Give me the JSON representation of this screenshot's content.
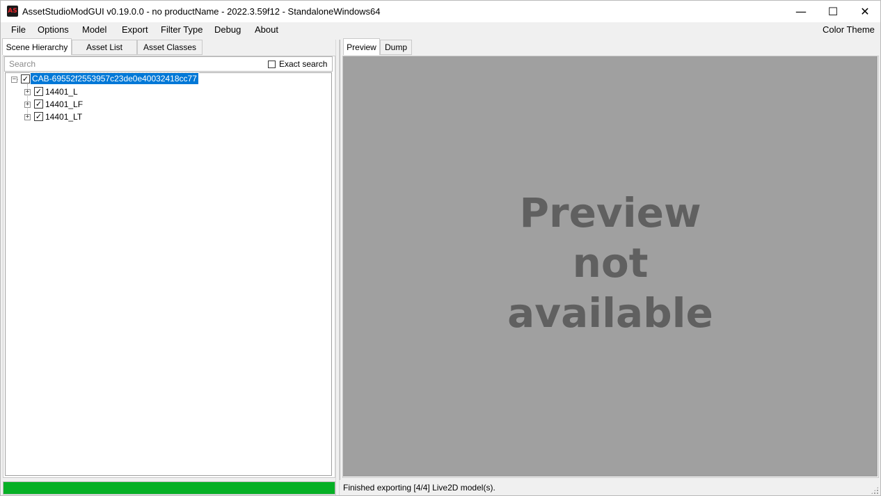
{
  "window": {
    "title": "AssetStudioModGUI v0.19.0.0 - no productName - 2022.3.59f12 - StandaloneWindows64",
    "app_icon_text": "AS",
    "min_glyph": "—",
    "max_glyph": "☐",
    "close_glyph": "✕"
  },
  "menu": {
    "items": [
      "File",
      "Options",
      "Model",
      "Export",
      "Filter Type",
      "Debug",
      "About"
    ],
    "color_theme": "Color Theme"
  },
  "left_tabs": [
    "Scene Hierarchy",
    "Asset List",
    "Asset Classes"
  ],
  "search": {
    "placeholder": "Search",
    "exact_label": "Exact search",
    "exact_checked": false
  },
  "tree": {
    "root": {
      "label": "CAB-69552f2553957c23de0e40032418cc77",
      "checked": true,
      "expanded": true,
      "selected": true
    },
    "children": [
      {
        "label": "14401_L",
        "checked": true,
        "expanded": false
      },
      {
        "label": "14401_LF",
        "checked": true,
        "expanded": false
      },
      {
        "label": "14401_LT",
        "checked": true,
        "expanded": false
      }
    ]
  },
  "progress": {
    "value_percent": 100,
    "color": "#06b025"
  },
  "right_tabs": [
    "Preview",
    "Dump"
  ],
  "preview": {
    "line1": "Preview",
    "line2": "not",
    "line3": "available"
  },
  "status": {
    "text": "Finished exporting [4/4] Live2D model(s)."
  },
  "colors": {
    "selection": "#0078d7",
    "preview_bg": "#a0a0a0",
    "preview_text": "#606060"
  }
}
